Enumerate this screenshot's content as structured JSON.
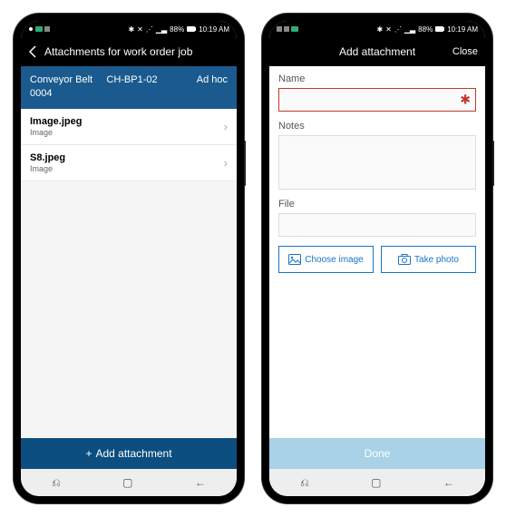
{
  "status": {
    "left_icons": "◦ ▣ ▫",
    "right_text": "88%",
    "time": "10:19 AM"
  },
  "left": {
    "title": "Attachments for work order job",
    "banner": {
      "line1a": "Conveyor Belt",
      "line1b": "CH-BP1-02",
      "right": "Ad hoc",
      "line2": "0004"
    },
    "items": [
      {
        "title": "Image.jpeg",
        "sub": "Image"
      },
      {
        "title": "S8.jpeg",
        "sub": "Image"
      }
    ],
    "add_label": "Add attachment"
  },
  "right": {
    "title": "Add attachment",
    "close": "Close",
    "name_label": "Name",
    "notes_label": "Notes",
    "file_label": "File",
    "choose_image": "Choose image",
    "take_photo": "Take photo",
    "done": "Done"
  }
}
